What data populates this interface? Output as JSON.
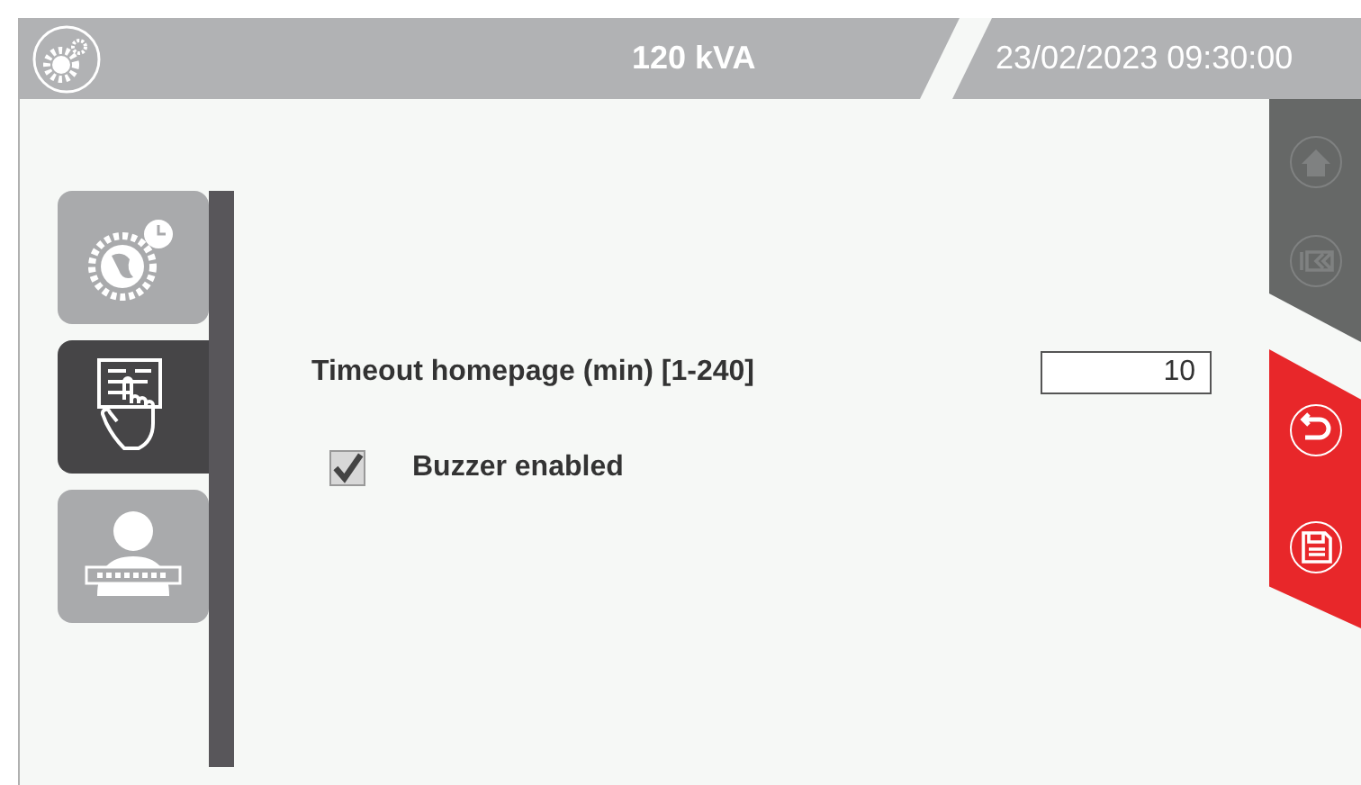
{
  "header": {
    "title": "120 kVA",
    "datetime": "23/02/2023 09:30:00"
  },
  "tabs": [
    {
      "kind": "regional",
      "selected": false
    },
    {
      "kind": "touch",
      "selected": true
    },
    {
      "kind": "password",
      "selected": false
    }
  ],
  "timeout": {
    "label": "Timeout homepage (min) [1-240]",
    "value": "10"
  },
  "buzzer": {
    "label": "Buzzer enabled",
    "checked": true
  },
  "nav_buttons": [
    {
      "kind": "home",
      "disabled": true
    },
    {
      "kind": "back",
      "disabled": true
    },
    {
      "kind": "undo",
      "disabled": false
    },
    {
      "kind": "save",
      "disabled": false
    }
  ]
}
